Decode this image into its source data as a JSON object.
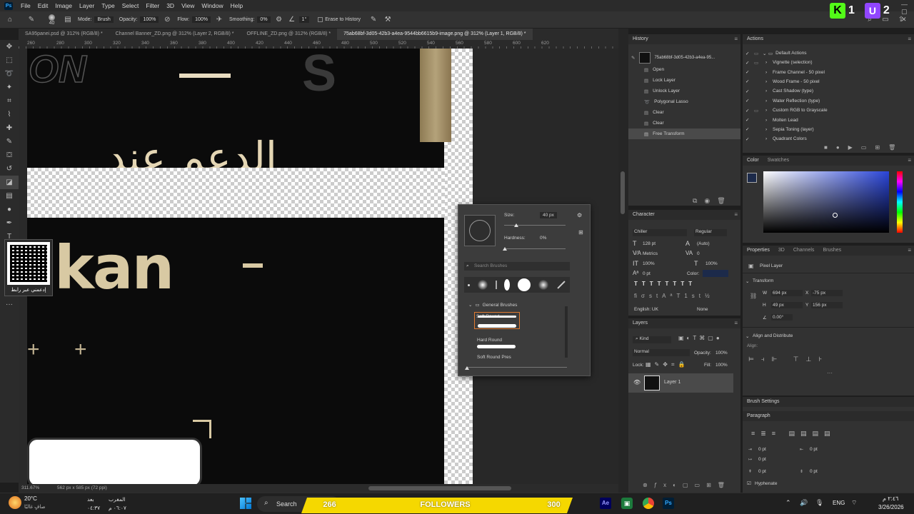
{
  "menubar": {
    "app_icon": "Ps",
    "items": [
      "File",
      "Edit",
      "Image",
      "Layer",
      "Type",
      "Select",
      "Filter",
      "3D",
      "View",
      "Window",
      "Help"
    ],
    "window_controls": "— ▢ ✕"
  },
  "options_bar": {
    "brush_size": "40",
    "mode_label": "Mode:",
    "mode_value": "Brush",
    "opacity_label": "Opacity:",
    "opacity_value": "100%",
    "flow_label": "Flow:",
    "flow_value": "100%",
    "smoothing_label": "Smoothing:",
    "smoothing_value": "0%",
    "angle_value": "1°",
    "erase_history": "Erase to History"
  },
  "stream_overlay": {
    "kick_count": "1",
    "k_letter": "K",
    "u_letter": "U",
    "u_count": "2"
  },
  "tabs": [
    {
      "label": "SA95panei.psd @ 312% (RGB/8) *"
    },
    {
      "label": "Channel Banner_ZD.png @ 312% (Layer 2, RGB/8) *"
    },
    {
      "label": "OFFLINE_ZD.png @ 312% (RGB/8) *"
    },
    {
      "label": "75ab68bf-3d05-42b3-a4ea-9544bb6615b9-image.png @ 312% (Layer 1, RGB/8) *",
      "active": true
    }
  ],
  "ruler": [
    "260",
    "280",
    "300",
    "320",
    "340",
    "360",
    "380",
    "400",
    "420",
    "440",
    "460",
    "480",
    "500",
    "520",
    "540",
    "560",
    "580",
    "600",
    "620"
  ],
  "status_bar": {
    "zoom": "311.67%",
    "doc_size": "562 px x 585 px (72 ppi)"
  },
  "canvas": {
    "text_on": "ON",
    "text_s": "S",
    "text_kan": "kan",
    "text_arabic": "الدعم عند",
    "qr_caption": "إدعمني عبر رابط"
  },
  "brush_popup": {
    "size_label": "Size:",
    "size_value": "40 px",
    "hardness_label": "Hardness:",
    "hardness_value": "0%",
    "search_placeholder": "Search Brushes",
    "folder": "General Brushes",
    "brushes": [
      "Soft Round",
      "Hard Round",
      "Soft Round Pres"
    ]
  },
  "history": {
    "title": "History",
    "snapshot": "75ab68bf-3d05-42b3-a4ea-95...",
    "items": [
      "Open",
      "Lock Layer",
      "Unlock Layer",
      "Polygonal Lasso",
      "Clear",
      "Clear",
      "Free Transform"
    ]
  },
  "actions": {
    "title": "Actions",
    "set": "Default Actions",
    "items": [
      "Vignette (selection)",
      "Frame Channel - 50 pixel",
      "Wood Frame - 50 pixel",
      "Cast Shadow (type)",
      "Water Reflection (type)",
      "Custom RGB to Grayscale",
      "Molten Lead",
      "Sepia Toning (layer)",
      "Quadrant Colors"
    ]
  },
  "color": {
    "tab1": "Color",
    "tab2": "Swatches",
    "accent": "#2a45d8"
  },
  "character": {
    "title": "Character",
    "font": "Chiller",
    "style": "Regular",
    "size": "128 pt",
    "leading": "(Auto)",
    "kerning": "Metrics",
    "tracking": "0",
    "vscale": "100%",
    "hscale": "100%",
    "baseline": "0 pt",
    "color_label": "Color:",
    "language": "English: UK",
    "aa": "None"
  },
  "properties": {
    "tabs": [
      "Properties",
      "3D",
      "Channels",
      "Brushes"
    ],
    "pixel_layer": "Pixel Layer",
    "transform": "Transform",
    "w": "694 px",
    "x": "-75 px",
    "h": "49 px",
    "y": "156 px",
    "angle": "0.00°",
    "align": "Align and Distribute",
    "align_sub": "Align:"
  },
  "layers": {
    "title": "Layers",
    "kind": "Kind",
    "blend": "Normal",
    "opacity_label": "Opacity:",
    "opacity": "100%",
    "lock_label": "Lock:",
    "fill_label": "Fill:",
    "fill": "100%",
    "layer_name": "Layer 1"
  },
  "brush_settings": {
    "title": "Brush Settings"
  },
  "paragraph": {
    "title": "Paragraph",
    "values": [
      "0 pt",
      "0 pt",
      "0 pt",
      "0 pt",
      "0 pt"
    ],
    "hyphenate": "Hyphenate"
  },
  "taskbar": {
    "weather_temp": "20°C",
    "weather_desc": "صافٍ غالبًا",
    "prayer1_name": "بعد",
    "prayer1_time": "٠٤:٣٧",
    "prayer2_name": "المغرب",
    "prayer2_time": "٠٦:٠٧ م",
    "search": "Search",
    "followers_left": "266",
    "followers_label": "FOLLOWERS",
    "followers_right": "300",
    "lang": "ENG",
    "time": "٢:٤٦ م",
    "date": "3/26/2026"
  }
}
